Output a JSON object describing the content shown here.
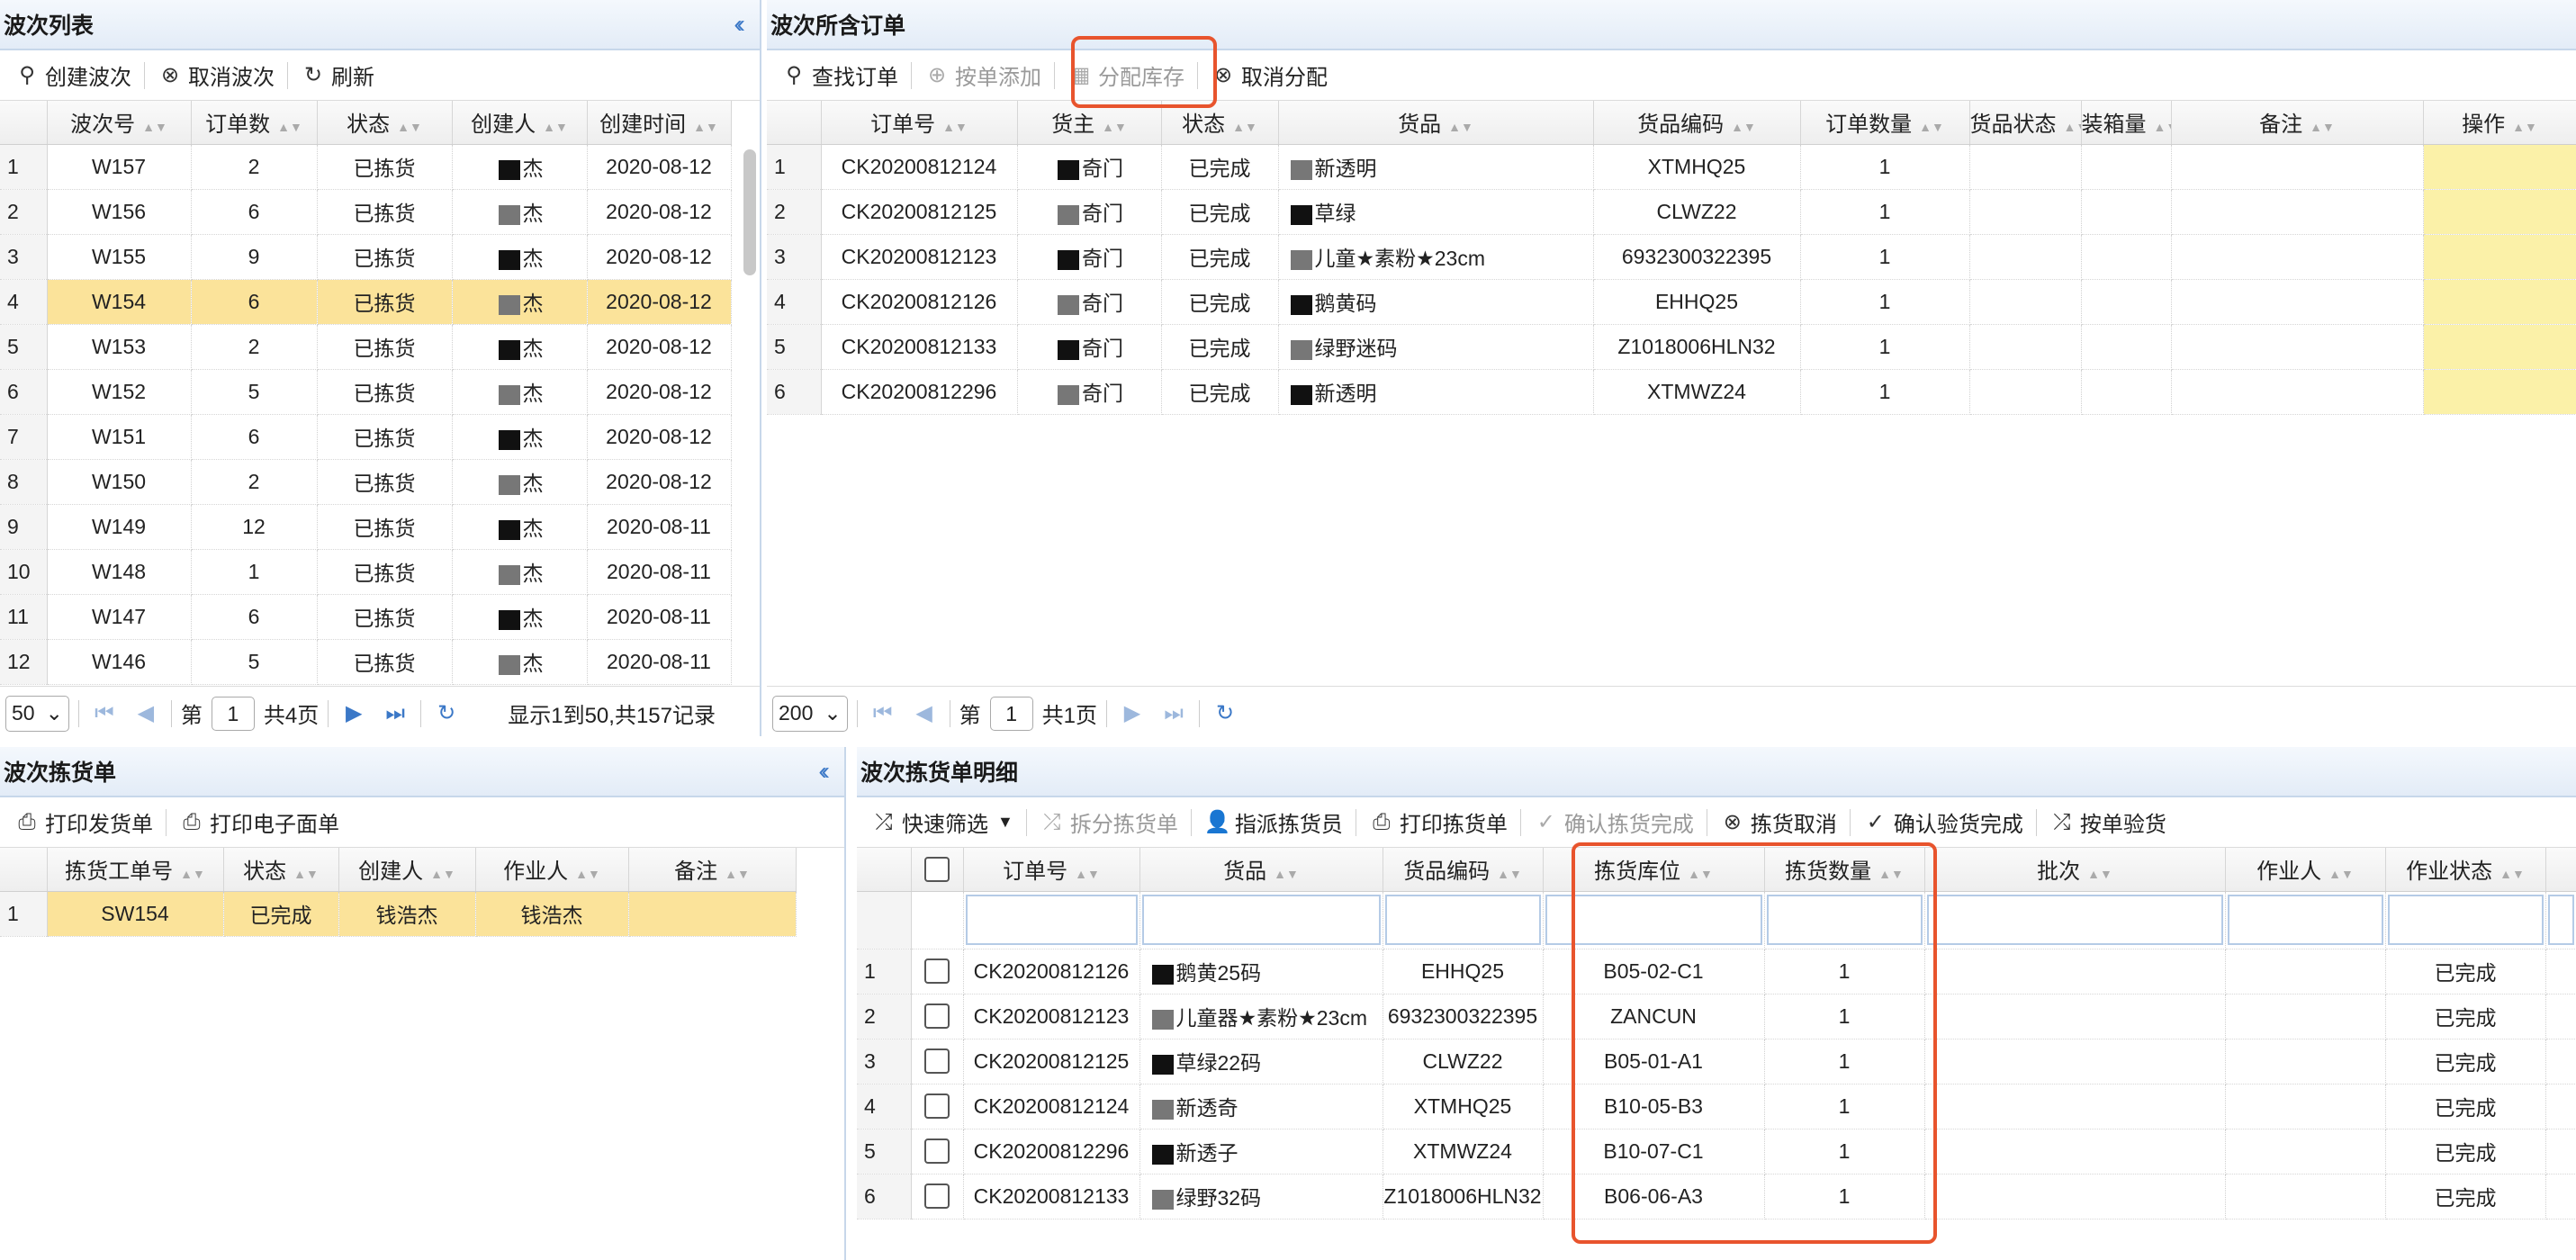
{
  "wave_list": {
    "title": "波次列表",
    "toolbar": {
      "create": "创建波次",
      "cancel": "取消波次",
      "refresh": "刷新"
    },
    "columns": [
      "波次号",
      "订单数",
      "状态",
      "创建人",
      "创建时间"
    ],
    "rows": [
      [
        "1",
        "W157",
        "2",
        "已拣货",
        "杰",
        "2020-08-12"
      ],
      [
        "2",
        "W156",
        "6",
        "已拣货",
        "杰",
        "2020-08-12"
      ],
      [
        "3",
        "W155",
        "9",
        "已拣货",
        "杰",
        "2020-08-12"
      ],
      [
        "4",
        "W154",
        "6",
        "已拣货",
        "杰",
        "2020-08-12"
      ],
      [
        "5",
        "W153",
        "2",
        "已拣货",
        "杰",
        "2020-08-12"
      ],
      [
        "6",
        "W152",
        "5",
        "已拣货",
        "杰",
        "2020-08-12"
      ],
      [
        "7",
        "W151",
        "6",
        "已拣货",
        "杰",
        "2020-08-12"
      ],
      [
        "8",
        "W150",
        "2",
        "已拣货",
        "杰",
        "2020-08-12"
      ],
      [
        "9",
        "W149",
        "12",
        "已拣货",
        "杰",
        "2020-08-11"
      ],
      [
        "10",
        "W148",
        "1",
        "已拣货",
        "杰",
        "2020-08-11"
      ],
      [
        "11",
        "W147",
        "6",
        "已拣货",
        "杰",
        "2020-08-11"
      ],
      [
        "12",
        "W146",
        "5",
        "已拣货",
        "杰",
        "2020-08-11"
      ]
    ],
    "pager": {
      "page_size": "50",
      "page_prefix": "第",
      "page": "1",
      "page_total": "共4页",
      "summary": "显示1到50,共157记录"
    }
  },
  "wave_orders": {
    "title": "波次所含订单",
    "toolbar": {
      "find": "查找订单",
      "add": "按单添加",
      "allocate": "分配库存",
      "cancel_alloc": "取消分配"
    },
    "columns": [
      "订单号",
      "货主",
      "状态",
      "货品",
      "货品编码",
      "订单数量",
      "货品状态",
      "装箱量",
      "备注",
      "操作"
    ],
    "rows": [
      [
        "1",
        "CK20200812124",
        "奇门",
        "已完成",
        "新透明",
        "XTMHQ25",
        "1"
      ],
      [
        "2",
        "CK20200812125",
        "奇门",
        "已完成",
        "草绿",
        "CLWZ22",
        "1"
      ],
      [
        "3",
        "CK20200812123",
        "奇门",
        "已完成",
        "儿童★素粉★23cm",
        "6932300322395",
        "1"
      ],
      [
        "4",
        "CK20200812126",
        "奇门",
        "已完成",
        "鹅黄码",
        "EHHQ25",
        "1"
      ],
      [
        "5",
        "CK20200812133",
        "奇门",
        "已完成",
        "绿野迷码",
        "Z1018006HLN32",
        "1"
      ],
      [
        "6",
        "CK20200812296",
        "奇门",
        "已完成",
        "新透明",
        "XTMWZ24",
        "1"
      ]
    ],
    "pager": {
      "page_size": "200",
      "page_prefix": "第",
      "page": "1",
      "page_total": "共1页"
    }
  },
  "pick_list": {
    "title": "波次拣货单",
    "toolbar": {
      "print_delivery": "打印发货单",
      "print_eorder": "打印电子面单"
    },
    "columns": [
      "拣货工单号",
      "状态",
      "创建人",
      "作业人",
      "备注"
    ],
    "rows": [
      [
        "1",
        "SW154",
        "已完成",
        "钱浩杰",
        "钱浩杰",
        ""
      ]
    ]
  },
  "pick_detail": {
    "title": "波次拣货单明细",
    "toolbar": {
      "quick_filter": "快速筛选",
      "split": "拆分拣货单",
      "assign": "指派拣货员",
      "print_pick": "打印拣货单",
      "confirm_pick": "确认拣货完成",
      "cancel_pick": "拣货取消",
      "confirm_check": "确认验货完成",
      "check_by_order": "按单验货"
    },
    "columns": [
      "订单号",
      "货品",
      "货品编码",
      "拣货库位",
      "拣货数量",
      "批次",
      "作业人",
      "作业状态"
    ],
    "rows": [
      [
        "1",
        "CK20200812126",
        "鹅黄25码",
        "EHHQ25",
        "B05-02-C1",
        "1",
        "已完成"
      ],
      [
        "2",
        "CK20200812123",
        "儿童器★素粉★23cm",
        "6932300322395",
        "ZANCUN",
        "1",
        "已完成"
      ],
      [
        "3",
        "CK20200812125",
        "草绿22码",
        "CLWZ22",
        "B05-01-A1",
        "1",
        "已完成"
      ],
      [
        "4",
        "CK20200812124",
        "新透奇",
        "XTMHQ25",
        "B10-05-B3",
        "1",
        "已完成"
      ],
      [
        "5",
        "CK20200812296",
        "新透子",
        "XTMWZ24",
        "B10-07-C1",
        "1",
        "已完成"
      ],
      [
        "6",
        "CK20200812133",
        "绿野32码",
        "Z1018006HLN32",
        "B06-06-A3",
        "1",
        "已完成"
      ]
    ]
  }
}
